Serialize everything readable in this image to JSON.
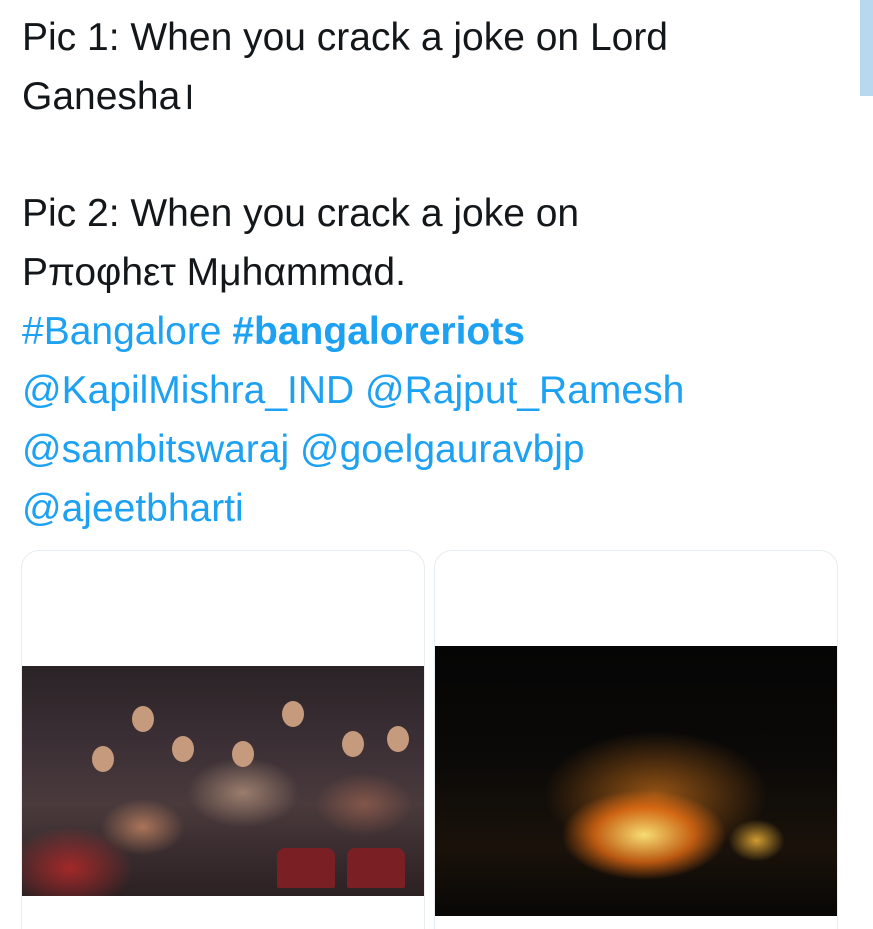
{
  "tweet": {
    "line1": "Pic 1: When you crack a joke on Lord",
    "line2": "Ganesha।",
    "line3": "Pic 2: When you crack a joke on",
    "line4": "Ρποφhετ Μμhαmmαd.",
    "hashtags": [
      "#Bangalore",
      "#bangaloreriots"
    ],
    "mentions": [
      "@KapilMishra_IND",
      "@Rajput_Ramesh",
      "@sambitswaraj",
      "@goelgauravbjp",
      "@ajeetbharti"
    ]
  },
  "media": [
    {
      "name": "theater-audience-laughing-photo"
    },
    {
      "name": "burning-vehicles-night-photo"
    }
  ],
  "colors": {
    "text": "#14171a",
    "link": "#1da1f2",
    "border": "#e6ecf0",
    "scroll_indicator": "#b7d8ef"
  }
}
